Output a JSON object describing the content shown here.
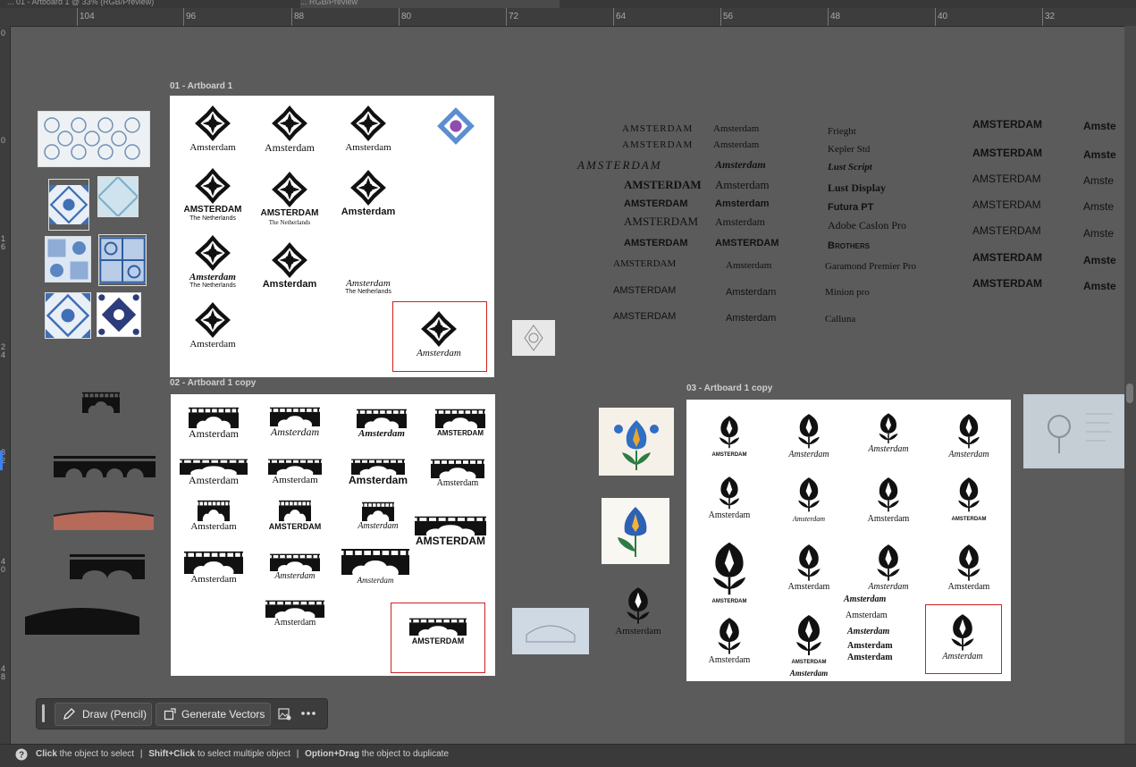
{
  "tabs": [
    {
      "label": "... 01 - Artboard 1 @ 33% (RGB/Preview)"
    },
    {
      "label": "... RGB/Preview"
    }
  ],
  "ruler": {
    "h_ticks": [
      "104",
      "96",
      "88",
      "80",
      "72",
      "64",
      "56",
      "48",
      "40",
      "32"
    ],
    "v_ticks": [
      "0",
      "0",
      "1 6",
      "2 4",
      "3 2",
      "4 0",
      "4 8"
    ]
  },
  "artboards": {
    "a1": {
      "label": "01 - Artboard 1"
    },
    "a2": {
      "label": "02 - Artboard 1 copy"
    },
    "a3": {
      "label": "03 - Artboard 1 copy"
    }
  },
  "words": {
    "amsterdam": "Amsterdam",
    "amsterdam_caps": "AMSTERDAM",
    "netherlands": "The Netherlands"
  },
  "fonts": {
    "col1": [
      "AMSTERDAM",
      "AMSTERDAM",
      "AMSTERDAM",
      "AMSTERDAM",
      "AMSTERDAM",
      "AMSTERDAM",
      "AMSTERDAM",
      "AMSTERDAM",
      "AMSTERDAM",
      "AMSTERDAM"
    ],
    "col2": [
      "Amsterdam",
      "Amsterdam",
      "Amsterdam",
      "Amsterdam",
      "Amsterdam",
      "Amsterdam",
      "AMSTERDAM",
      "Amsterdam",
      "Amsterdam",
      "Amsterdam"
    ],
    "names": [
      "Frieght",
      "Kepler Std",
      "Lust Script",
      "Lust Display",
      "Futura PT",
      "Adobe Caslon Pro",
      "Brothers",
      "Garamond Premier Pro",
      "Minion pro",
      "Calluna"
    ],
    "col4": [
      "AMSTERDAM",
      "AMSTERDAM",
      "AMSTERDAM",
      "AMSTERDAM",
      "AMSTERDAM",
      "AMSTERDAM",
      "AMSTERDAM"
    ],
    "col5": [
      "Amste",
      "Amste",
      "Amste",
      "Amste",
      "Amste",
      "Amste",
      "Amste"
    ]
  },
  "toolbar": {
    "draw": "Draw (Pencil)",
    "generate": "Generate Vectors"
  },
  "status": {
    "k1": "Click",
    "t1": " the object to select",
    "k2": "Shift+Click",
    "t2": " to select multiple object",
    "k3": "Option+Drag",
    "t3": " the object to duplicate",
    "sep": "|"
  },
  "colors": {
    "canvas": "#5b5b5b",
    "selection": "#d02020",
    "tile_blue": "#3f6fb5",
    "bridge_brick": "#b66a5a"
  }
}
